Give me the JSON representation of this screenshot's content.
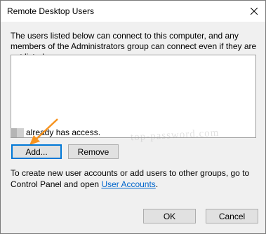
{
  "window": {
    "title": "Remote Desktop Users"
  },
  "dialog": {
    "description": "The users listed below can connect to this computer, and any members of the Administrators group can connect even if they are not listed.",
    "access_text": "already has access.",
    "add_label": "Add...",
    "remove_label": "Remove",
    "bottom_text_prefix": "To create new user accounts or add users to other groups, go to Control Panel and open ",
    "user_accounts_link": "User Accounts",
    "bottom_text_suffix": ".",
    "ok_label": "OK",
    "cancel_label": "Cancel"
  },
  "watermark": "top-password.com",
  "colors": {
    "accent": "#0078d7",
    "arrow": "#f7931e",
    "link": "#0066cc"
  },
  "icons": [
    "close-icon",
    "user-icon",
    "arrow-icon"
  ]
}
